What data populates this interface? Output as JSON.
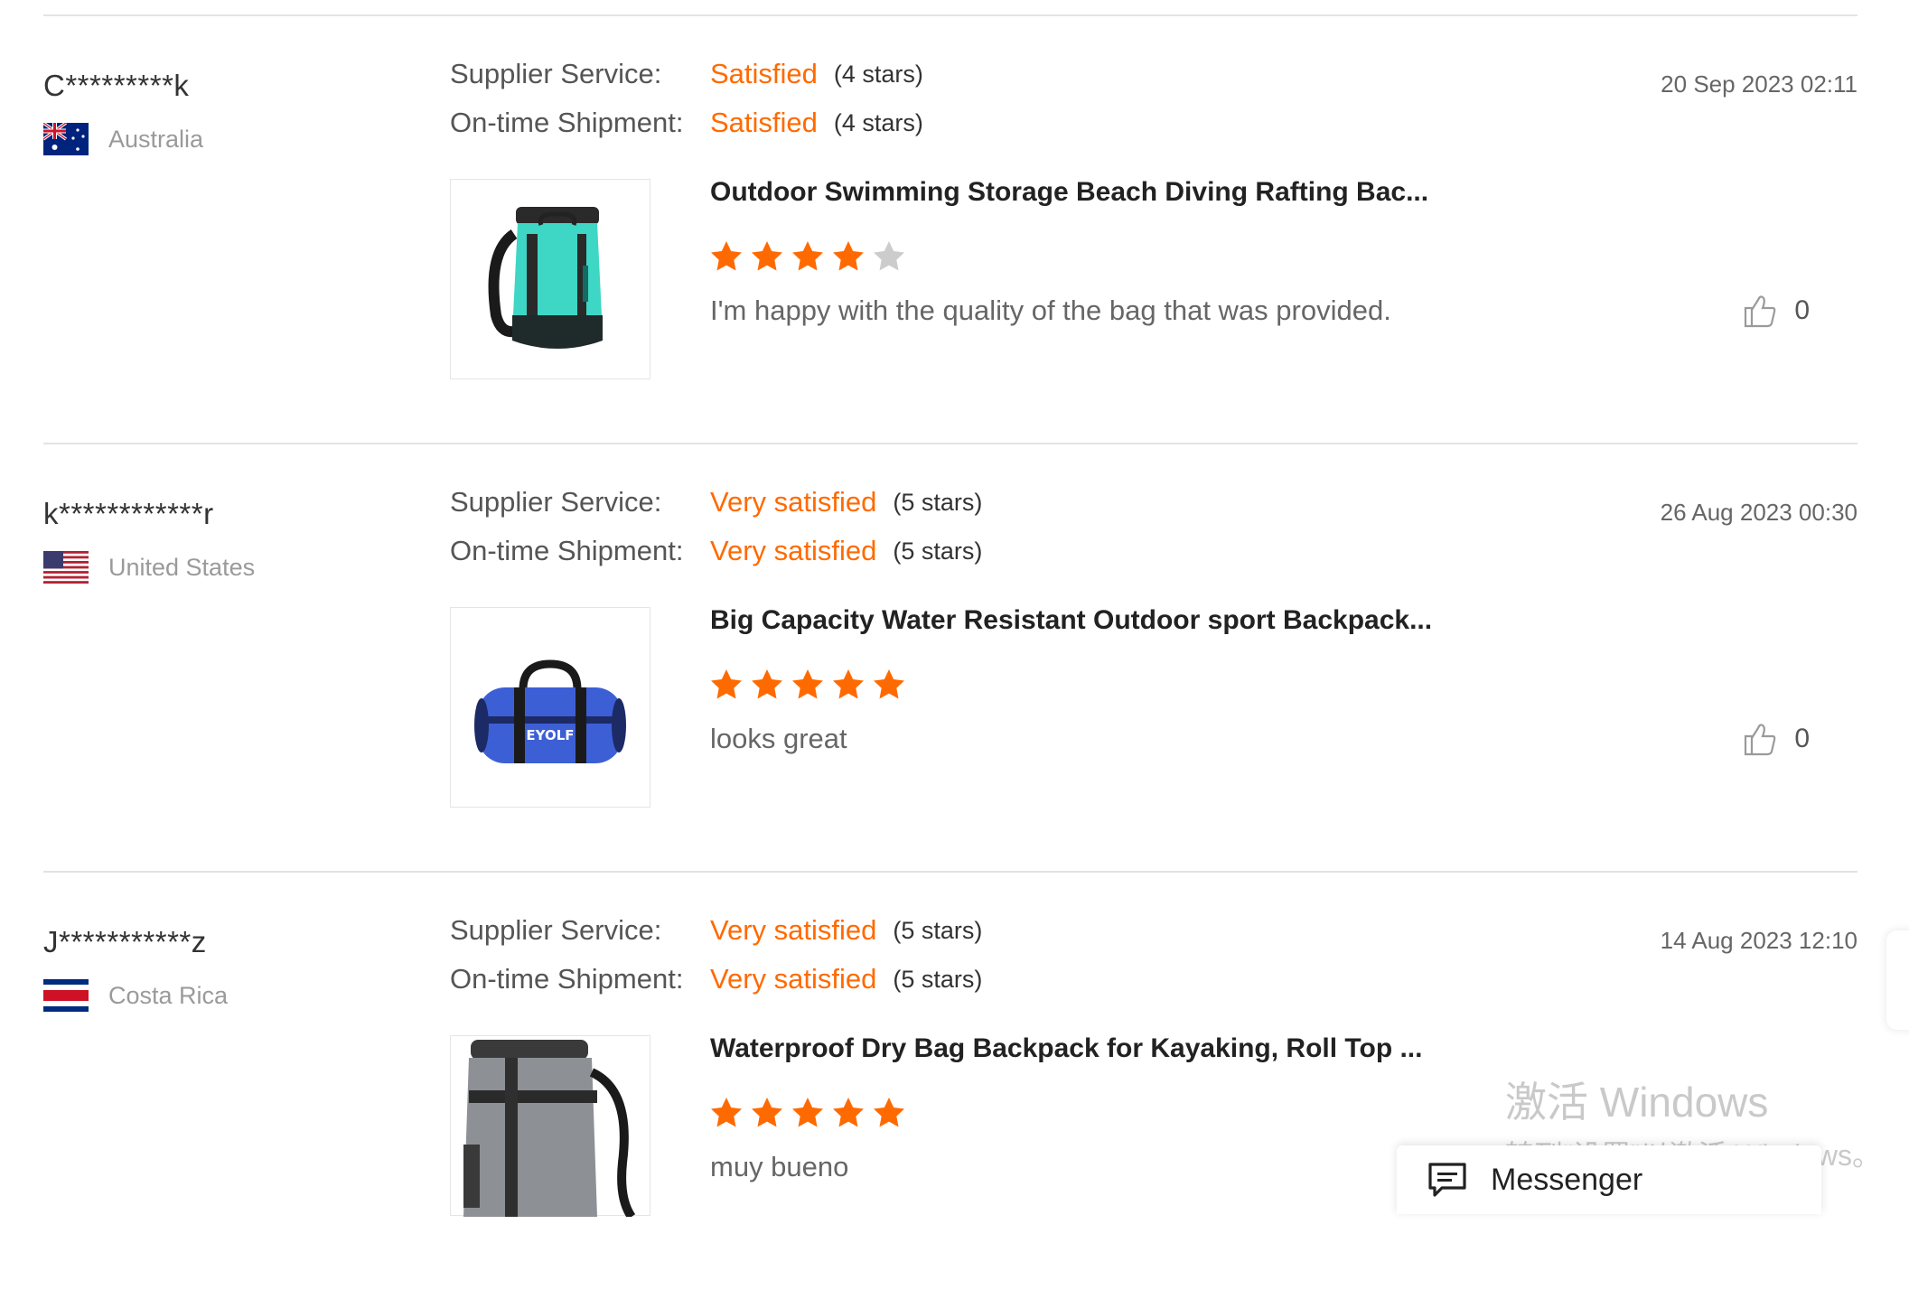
{
  "labels": {
    "supplier_service": "Supplier Service:",
    "ontime_shipment": "On-time Shipment:"
  },
  "colors": {
    "accent": "#ff6a00",
    "star_empty": "#cccccc"
  },
  "reviews": [
    {
      "user": "C*********k",
      "country": "Australia",
      "flag": "australia-flag",
      "date": "20 Sep 2023 02:11",
      "supplier_service": {
        "value": "Satisfied",
        "stars_text": "(4 stars)"
      },
      "ontime_shipment": {
        "value": "Satisfied",
        "stars_text": "(4 stars)"
      },
      "product_title": "Outdoor Swimming Storage Beach Diving Rafting Bac...",
      "product_image": "teal-dry-bag-backpack",
      "rating": 4,
      "comment": "I'm happy with the quality of the bag that was provided.",
      "likes": "0"
    },
    {
      "user": "k************r",
      "country": "United States",
      "flag": "usa-flag",
      "date": "26 Aug 2023 00:30",
      "supplier_service": {
        "value": "Very satisfied",
        "stars_text": "(5 stars)"
      },
      "ontime_shipment": {
        "value": "Very satisfied",
        "stars_text": "(5 stars)"
      },
      "product_title": "Big Capacity Water Resistant Outdoor sport Backpack...",
      "product_image": "blue-duffel-bag",
      "product_image_text": "EYOLF",
      "rating": 5,
      "comment": "looks great",
      "likes": "0"
    },
    {
      "user": "J***********z",
      "country": "Costa Rica",
      "flag": "costa-rica-flag",
      "date": "14 Aug 2023 12:10",
      "supplier_service": {
        "value": "Very satisfied",
        "stars_text": "(5 stars)"
      },
      "ontime_shipment": {
        "value": "Very satisfied",
        "stars_text": "(5 stars)"
      },
      "product_title": "Waterproof Dry Bag Backpack for Kayaking, Roll Top ...",
      "product_image": "grey-dry-bag-backpack",
      "rating": 5,
      "comment": "muy bueno",
      "likes": ""
    }
  ],
  "watermark": {
    "line1": "激活 Windows",
    "line2": "转到“设置”以激活 Windows。"
  },
  "messenger": {
    "label": "Messenger",
    "icon": "chat-icon"
  }
}
